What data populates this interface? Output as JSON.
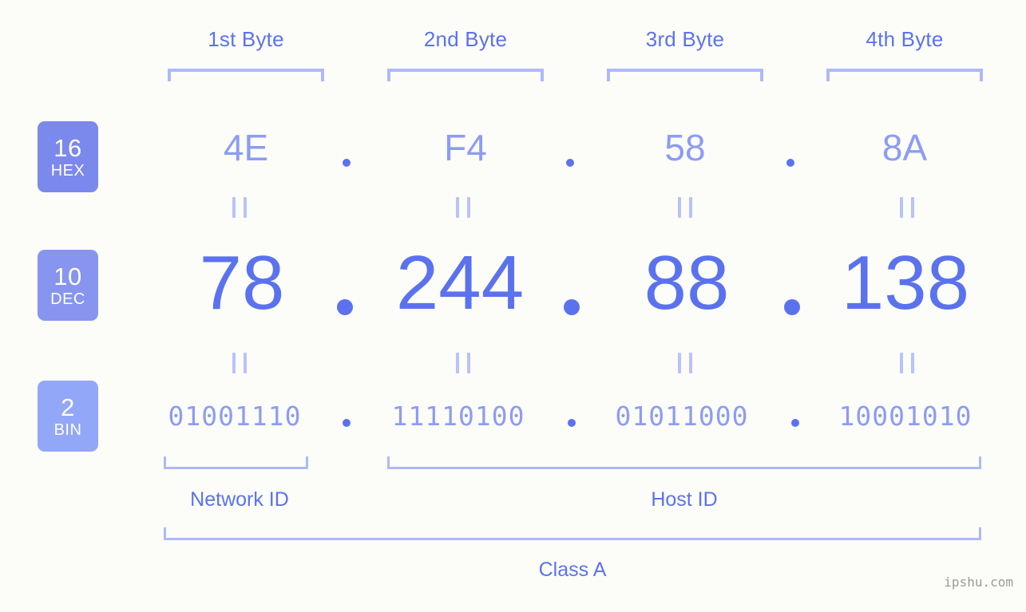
{
  "background_color": "#fcfdf8",
  "accent_color": "#5b72ef",
  "accent_light_color": "#8d9cf3",
  "bracket_color": "#aeb9fb",
  "byte_headers": [
    {
      "label": "1st Byte"
    },
    {
      "label": "2nd Byte"
    },
    {
      "label": "3rd Byte"
    },
    {
      "label": "4th Byte"
    }
  ],
  "rows": {
    "hex": {
      "badge_number": "16",
      "badge_abbr": "HEX",
      "badge_color": "#7b88ec",
      "values": [
        "4E",
        "F4",
        "58",
        "8A"
      ],
      "separator": "."
    },
    "dec": {
      "badge_number": "10",
      "badge_abbr": "DEC",
      "badge_color": "#8795f1",
      "values": [
        "78",
        "244",
        "88",
        "138"
      ],
      "separator": "."
    },
    "bin": {
      "badge_number": "2",
      "badge_abbr": "BIN",
      "badge_color": "#93a7f8",
      "values": [
        "01001110",
        "11110100",
        "01011000",
        "10001010"
      ],
      "separator": "."
    }
  },
  "equals_symbol": "=",
  "sections": {
    "network_id": "Network ID",
    "host_id": "Host ID",
    "class": "Class A"
  },
  "watermark": "ipshu.com"
}
